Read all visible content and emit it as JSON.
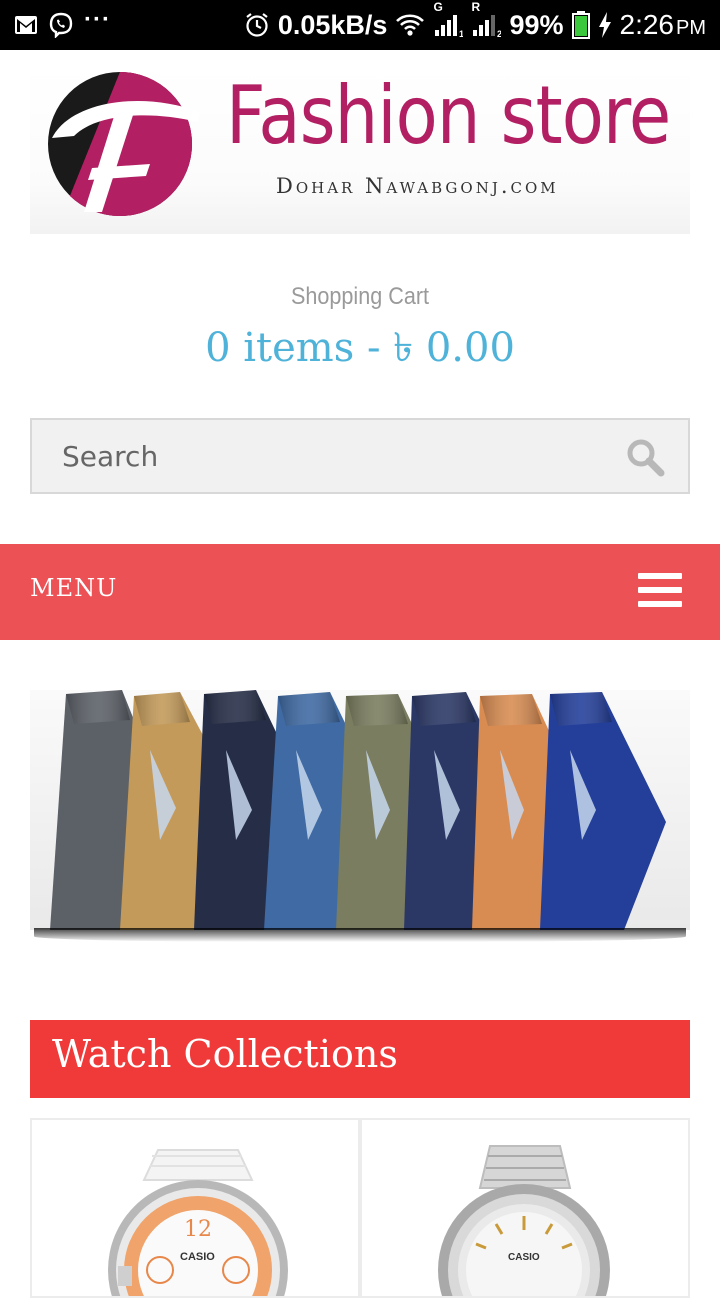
{
  "status_bar": {
    "net_speed": "0.05kB/s",
    "battery": "99%",
    "time": "2:26",
    "ampm": "PM",
    "sim1_label": "G",
    "sim2_label": "R",
    "overflow": "···"
  },
  "logo": {
    "title": "Fashion store",
    "subtitle": "Dohar Nawabgonj.com",
    "colors": {
      "primary": "#b21f62",
      "dark": "#1a1a1a"
    }
  },
  "cart": {
    "label": "Shopping Cart",
    "summary": "0 items - ৳ 0.00"
  },
  "search": {
    "placeholder": "Search"
  },
  "menu": {
    "label": "MENU"
  },
  "sections": {
    "watch_title": "Watch Collections"
  },
  "products": [
    {
      "brand": "CASIO"
    },
    {
      "brand": "CASIO"
    }
  ],
  "colors": {
    "menu_bar": "#ec5156",
    "section_bar": "#f03a3a",
    "cart_accent": "#4fb2d9"
  }
}
